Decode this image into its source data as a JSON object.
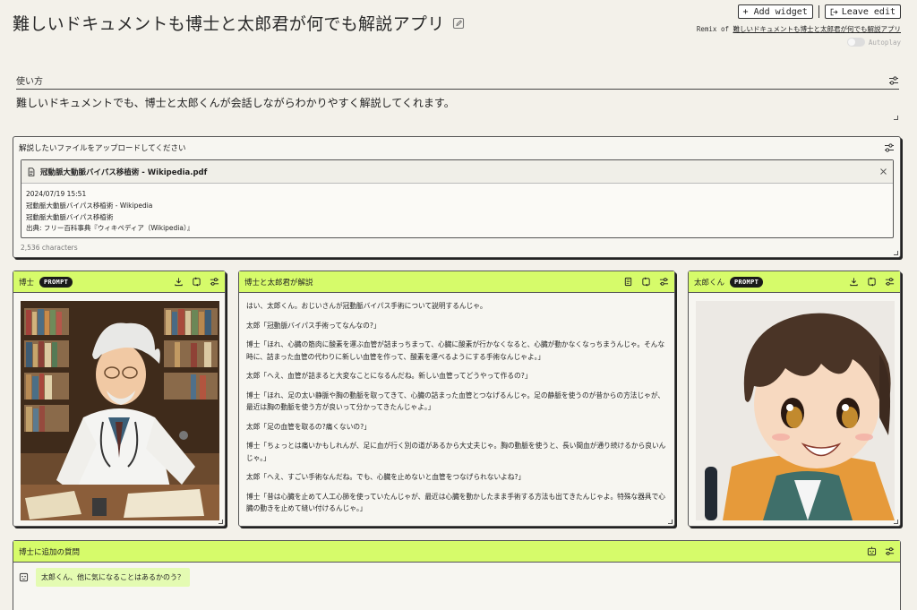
{
  "header": {
    "title": "難しいドキュメントも博士と太郎君が何でも解説アプリ",
    "add_widget_label": "+ Add widget",
    "leave_edit_label": "Leave edit",
    "remix_prefix": "Remix of",
    "remix_link": "難しいドキュメントも博士と太郎君が何でも解説アプリ",
    "autoplay_label": "Autoplay"
  },
  "usage": {
    "label": "使い方",
    "text": "難しいドキュメントでも、博士と太郎くんが会話しながらわかりやすく解説してくれます。"
  },
  "upload": {
    "label": "解説したいファイルをアップロードしてください",
    "file_name": "冠動脈大動脈バイパス移植術 - Wikipedia.pdf",
    "meta": [
      "2024/07/19 15:51",
      "冠動脈大動脈バイパス移植術 - Wikipedia",
      "冠動脈大動脈バイパス移植術",
      "出典: フリー百科事典『ウィキペディア（Wikipedia）』"
    ],
    "char_count": "2,536 characters"
  },
  "hakase": {
    "label": "博士",
    "badge": "PROMPT"
  },
  "kaisetsu": {
    "label": "博士と太郎君が解説",
    "lines": [
      "はい、太郎くん。おじいさんが冠動脈バイパス手術について説明するんじゃ。",
      "太郎「冠動脈バイパス手術ってなんなの?」",
      "博士「ほれ、心臓の筋肉に酸素を運ぶ血管が詰まっちまって、心臓に酸素が行かなくなると、心臓が動かなくなっちまうんじゃ。そんな時に、詰まった血管の代わりに新しい血管を作って、酸素を運べるようにする手術なんじゃよ。」",
      "太郎「へえ、血管が詰まると大変なことになるんだね。新しい血管ってどうやって作るの?」",
      "博士「ほれ、足の太い静脈や胸の動脈を取ってきて、心臓の詰まった血管とつなげるんじゃ。足の静脈を使うのが昔からの方法じゃが、最近は胸の動脈を使う方が良いって分かってきたんじゃよ。」",
      "太郎「足の血管を取るの?痛くないの?」",
      "博士「ちょっとは痛いかもしれんが、足に血が行く別の道があるから大丈夫じゃ。胸の動脈を使うと、長い間血が通り続けるから良いんじゃ。」",
      "太郎「へえ、すごい手術なんだね。でも、心臓を止めないと血管をつなげられないよね?」",
      "博士「昔は心臓を止めて人工心肺を使っていたんじゃが、最近は心臓を動かしたまま手術する方法も出てきたんじゃよ。特殊な器具で心臓の動きを止めて縫い付けるんじゃ。」"
    ]
  },
  "taro": {
    "label": "太郎くん",
    "badge": "PROMPT"
  },
  "followup": {
    "label": "博士に追加の質問",
    "message": "太郎くん、他に気になることはあるかのう？"
  },
  "colors": {
    "accent": "#d6fb6a",
    "background": "#f3f1ea",
    "bubble": "#e4fbb2"
  }
}
